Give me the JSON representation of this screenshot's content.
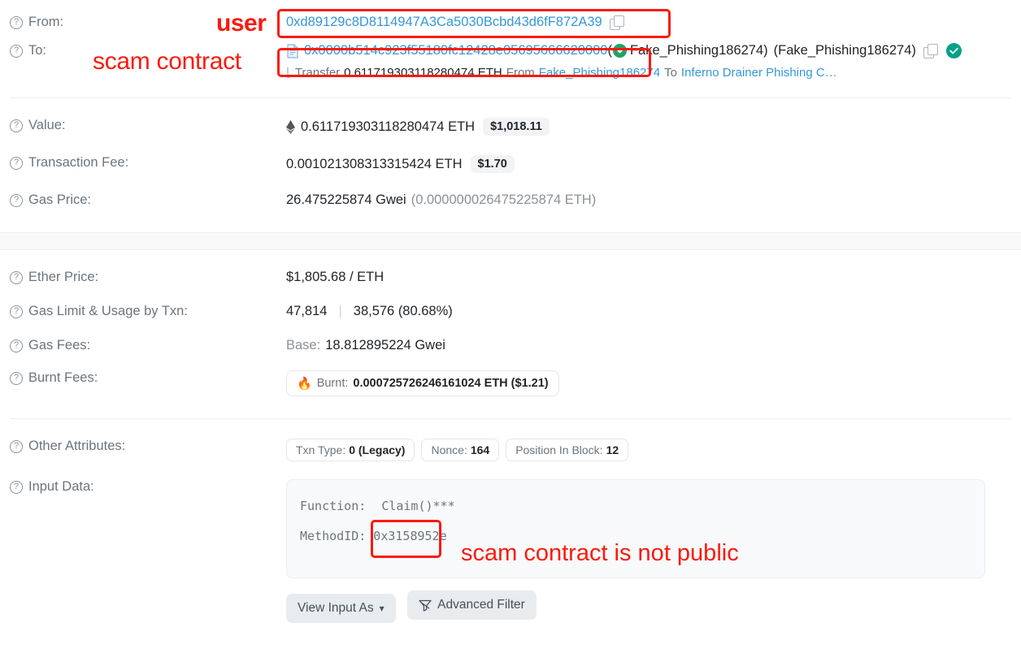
{
  "rows": {
    "from": {
      "label": "From:",
      "address": "0xd89129c8D8114947A3Ca5030Bcbd43d6fF872A39"
    },
    "to": {
      "label": "To:",
      "address": "0x0000b514c923f55180fc12428e05695666620000",
      "tag_inline": "Fake_Phishing186274)",
      "tag_paren": "(Fake_Phishing186274)"
    },
    "transfer": {
      "prefix": "Transfer",
      "amount": "0.611719303118280474 ETH",
      "from_word": "From",
      "from_name": "Fake_Phishing186274",
      "to_word": "To",
      "to_name": "Inferno Drainer Phishing C…"
    },
    "value": {
      "label": "Value:",
      "amount": "0.611719303118280474 ETH",
      "fiat": "$1,018.11"
    },
    "txn_fee": {
      "label": "Transaction Fee:",
      "amount": "0.001021308313315424 ETH",
      "fiat": "$1.70"
    },
    "gas_price": {
      "label": "Gas Price:",
      "value": "26.475225874 Gwei",
      "eth": "(0.000000026475225874 ETH)"
    },
    "ether_price": {
      "label": "Ether Price:",
      "value": "$1,805.68 / ETH"
    },
    "gas_limit": {
      "label": "Gas Limit & Usage by Txn:",
      "limit": "47,814",
      "sep": "|",
      "used": "38,576 (80.68%)"
    },
    "gas_fees": {
      "label": "Gas Fees:",
      "base_word": "Base:",
      "base_value": "18.812895224 Gwei"
    },
    "burnt_fees": {
      "label": "Burnt Fees:",
      "icon": "fire-icon",
      "word": "Burnt:",
      "value": "0.000725726246161024 ETH ($1.21)"
    },
    "other_attributes": {
      "label": "Other Attributes:",
      "items": [
        {
          "key": "Txn Type:",
          "value": "0 (Legacy)"
        },
        {
          "key": "Nonce:",
          "value": "164"
        },
        {
          "key": "Position In Block:",
          "value": "12"
        }
      ]
    },
    "input_data": {
      "label": "Input Data:",
      "function_key": "Function:",
      "function_value": "Claim()",
      "function_suffix": "***",
      "method_line": "MethodID: 0x3158952e",
      "view_input_as": "View Input As",
      "advanced_filter": "Advanced Filter"
    }
  },
  "annotations": {
    "user": "user",
    "scam_contract": "scam contract",
    "not_public": "scam contract is not public"
  },
  "colors": {
    "annotation_red": "#fb1a0e",
    "link_blue": "#3498db",
    "muted_gray": "#6c757d",
    "verified_green": "#00a186",
    "tag_green": "#21a366"
  }
}
